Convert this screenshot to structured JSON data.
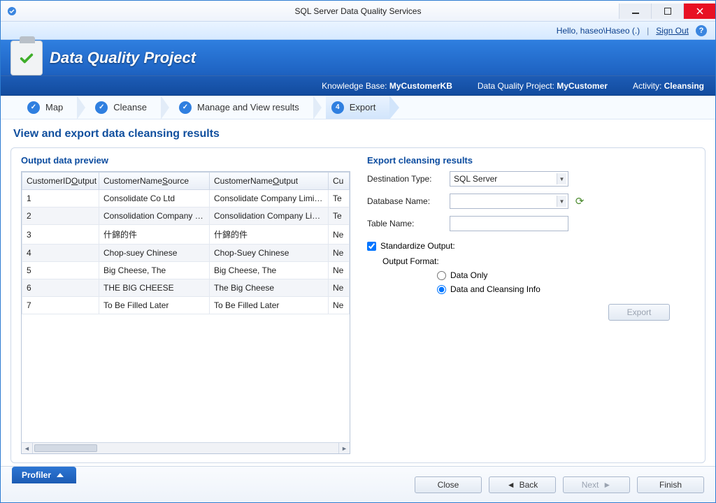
{
  "window": {
    "title": "SQL Server Data Quality Services"
  },
  "user_strip": {
    "greeting": "Hello, haseo\\Haseo (.)",
    "sign_out": "Sign Out"
  },
  "banner": {
    "heading": "Data Quality Project",
    "kb_label": "Knowledge Base:",
    "kb_value": "MyCustomerKB",
    "proj_label": "Data Quality Project:",
    "proj_value": "MyCustomer",
    "act_label": "Activity:",
    "act_value": "Cleansing"
  },
  "steps": {
    "s1": "Map",
    "s2": "Cleanse",
    "s3": "Manage and View results",
    "s4": "Export",
    "s4_num": "4"
  },
  "page": {
    "heading": "View and export data cleansing results"
  },
  "left": {
    "title": "Output data preview",
    "columns": {
      "c0_pre": "CustomerID",
      "c0_u": "O",
      "c0_post": "utput",
      "c1_pre": "CustomerName",
      "c1_u": "S",
      "c1_post": "ource",
      "c2_pre": "CustomerName",
      "c2_u": "O",
      "c2_post": "utput",
      "c3": "Cu"
    },
    "rows": [
      {
        "id": "1",
        "src": "Consolidate Co Ltd",
        "out": "Consolidate Company Limited",
        "extra": "Te"
      },
      {
        "id": "2",
        "src": "Consolidation Company Ltd",
        "out": "Consolidation Company Limited",
        "extra": "Te"
      },
      {
        "id": "3",
        "src": "什錦的件",
        "out": "什錦的件",
        "extra": "Ne"
      },
      {
        "id": "4",
        "src": "Chop-suey Chinese",
        "out": "Chop-Suey Chinese",
        "extra": "Ne"
      },
      {
        "id": "5",
        "src": "Big Cheese, The",
        "out": "Big Cheese, The",
        "extra": "Ne"
      },
      {
        "id": "6",
        "src": "THE BIG CHEESE",
        "out": "The Big Cheese",
        "extra": "Ne"
      },
      {
        "id": "7",
        "src": "To Be Filled Later",
        "out": "To Be Filled Later",
        "extra": "Ne"
      }
    ]
  },
  "right": {
    "title": "Export cleansing results",
    "dest_label": "Destination Type:",
    "dest_value": "SQL Server",
    "db_label": "Database Name:",
    "db_value": "",
    "table_label": "Table Name:",
    "table_value": "",
    "standardize": "Standardize Output:",
    "standardize_checked": true,
    "output_format": "Output Format:",
    "radio_data_only": "Data Only",
    "radio_data_info": "Data and Cleansing Info",
    "radio_selected": "info",
    "export_btn": "Export"
  },
  "footer": {
    "profiler": "Profiler",
    "close": "Close",
    "back": "Back",
    "next": "Next",
    "finish": "Finish"
  }
}
